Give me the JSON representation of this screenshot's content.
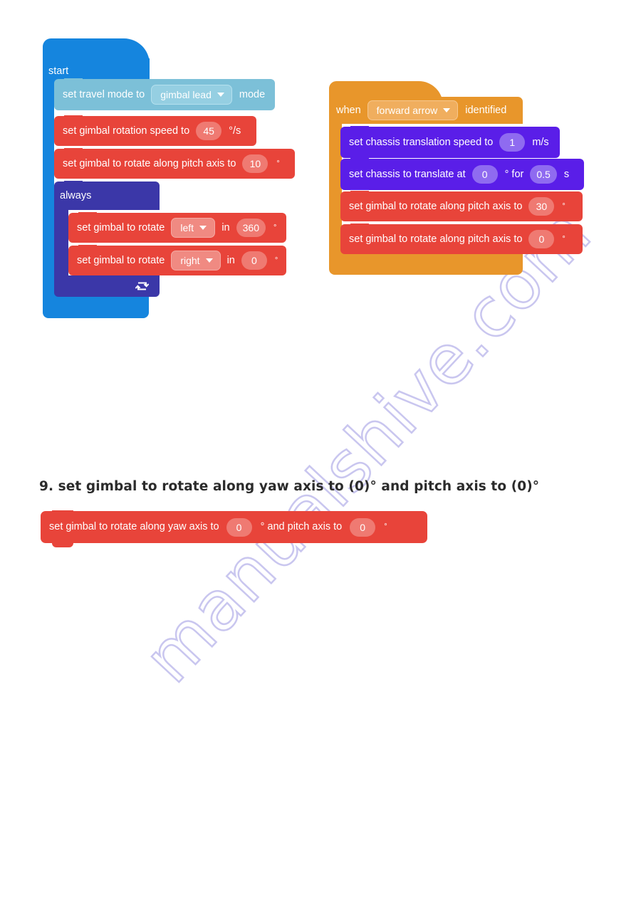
{
  "page": {
    "watermark": "manualshive.com",
    "watermark_color": "#c9c6ef",
    "background": "#ffffff"
  },
  "heading": {
    "text": "9. set gimbal to rotate along yaw axis to (0)° and pitch axis to (0)°"
  },
  "colors": {
    "start_blue": "#1585de",
    "light_blue": "#7cc0d8",
    "red": "#e8443a",
    "indigo": "#3b37a8",
    "orange": "#e8962b",
    "purple": "#5a1ee8"
  },
  "program_left": {
    "hat_label": "start",
    "blocks": [
      {
        "id": "travel-mode",
        "color": "light_blue",
        "prefix": "set travel mode to",
        "dropdown": "gimbal lead",
        "suffix": "mode"
      },
      {
        "id": "gimbal-rotation-speed",
        "color": "red",
        "prefix": "set gimbal rotation speed to",
        "value": "45",
        "unit": "°/s"
      },
      {
        "id": "gimbal-pitch-axis",
        "color": "red",
        "prefix": "set gimbal to rotate along pitch axis to",
        "value": "10",
        "unit": "°"
      }
    ],
    "loop": {
      "label": "always",
      "icon": "loop-icon",
      "blocks": [
        {
          "id": "gimbal-rotate-left",
          "color": "red",
          "prefix": "set gimbal to rotate",
          "dropdown": "left",
          "mid": "in",
          "value": "360",
          "unit": "°"
        },
        {
          "id": "gimbal-rotate-right",
          "color": "red",
          "prefix": "set gimbal to rotate",
          "dropdown": "right",
          "mid": "in",
          "value": "0",
          "unit": "°"
        }
      ]
    }
  },
  "program_right": {
    "hat_prefix": "when",
    "hat_dropdown": "forward arrow",
    "hat_suffix": "identified",
    "blocks": [
      {
        "id": "chassis-translation-speed",
        "color": "purple",
        "prefix": "set chassis translation speed to",
        "value": "1",
        "unit": "m/s"
      },
      {
        "id": "chassis-translate-at",
        "color": "purple",
        "prefix": "set chassis to translate at",
        "value": "0",
        "mid": "° for",
        "value2": "0.5",
        "unit": "s"
      },
      {
        "id": "gimbal-pitch-30",
        "color": "red",
        "prefix": "set gimbal to rotate along pitch axis to",
        "value": "30",
        "unit": "°"
      },
      {
        "id": "gimbal-pitch-0",
        "color": "red",
        "prefix": "set gimbal to rotate along pitch axis to",
        "value": "0",
        "unit": "°"
      }
    ]
  },
  "standalone_block": {
    "id": "gimbal-yaw-pitch",
    "color": "red",
    "prefix": "set gimbal to rotate along yaw axis to",
    "value": "0",
    "mid": "° and pitch axis to",
    "value2": "0",
    "unit": "°"
  }
}
